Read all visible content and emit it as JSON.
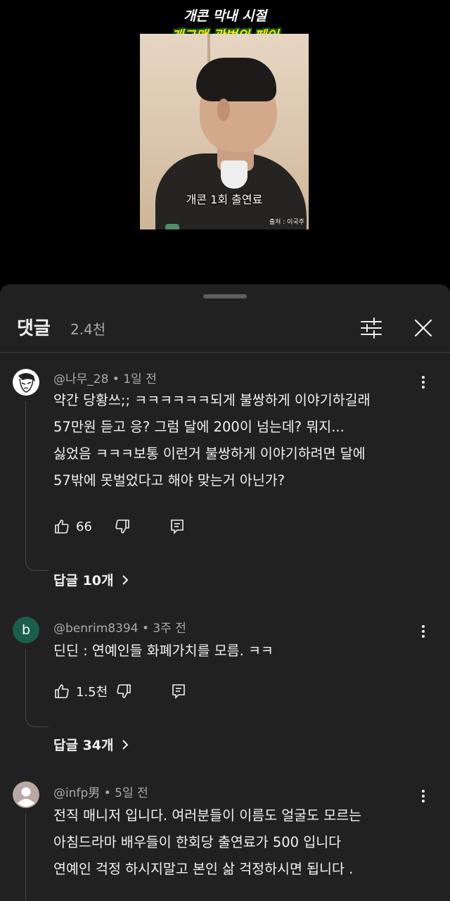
{
  "video": {
    "title_line1": "개콘 막내 시절",
    "title_line2": "개그맨 곽범의 페이",
    "subtitle": "개콘 1회 출연료",
    "credit": "출처 : 이국주"
  },
  "comments_panel": {
    "title": "댓글",
    "count": "2.4천",
    "filter_icon": "sliders-icon",
    "close_icon": "close-icon"
  },
  "comments": [
    {
      "author": "@나무_28",
      "time": "1일 전",
      "lines": [
        "약간 당황쓰;; ㅋㅋㅋㅋㅋㅋ되게 불쌍하게 이야기하길래",
        "57만원 듣고 응? 그럼 달에 200이 넘는데? 뭐지...",
        "싫었음 ㅋㅋㅋ보통 이런거 불쌍하게 이야기하려면 달에",
        "57밖에 못벌었다고 해야 맞는거 아닌가?"
      ],
      "likes": "66",
      "replies_label": "답글 10개",
      "avatar": "drawn-face"
    },
    {
      "author": "@benrim8394",
      "time": "3주 전",
      "lines": [
        "딘딘 :  연예인들 화폐가치를 모름.  ㅋㅋ"
      ],
      "likes": "1.5천",
      "replies_label": "답글 34개",
      "avatar_letter": "b",
      "avatar_color": "#1b5e4a"
    },
    {
      "author": "@infp男",
      "time": "5일 전",
      "lines": [
        "전직 매니저 입니다. 여러분들이 이름도 얼굴도 모르는",
        "아침드라마 배우들이 한회당 출연료가 500 입니다",
        "연예인 걱정 하시지말고 본인 삶 걱정하시면 됩니다 ."
      ],
      "avatar": "default-user"
    }
  ],
  "meta_separator": "•",
  "colors": {
    "sheet_bg": "#212121",
    "text_primary": "#f1f1f1",
    "text_secondary": "#aaaaaa",
    "title_yellow": "#ffe100",
    "title_outline_green": "#0d5f1c"
  }
}
